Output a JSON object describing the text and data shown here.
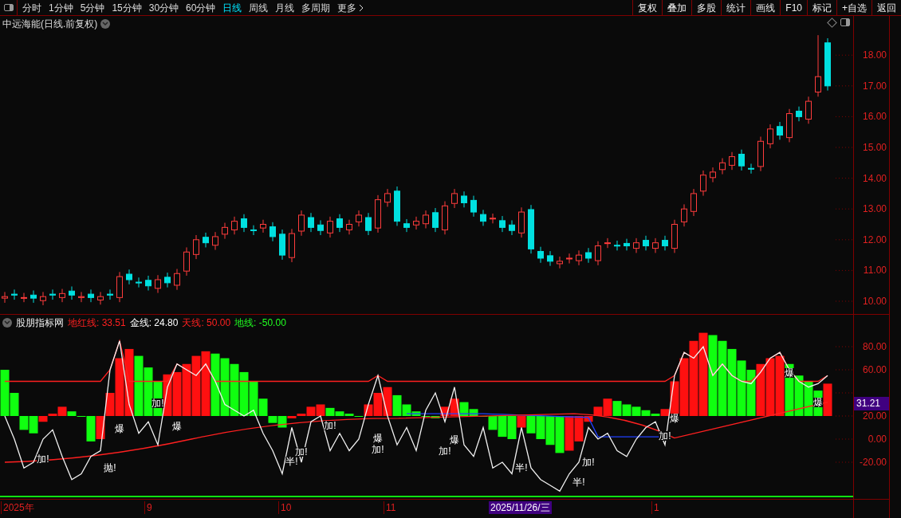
{
  "toolbar": {
    "period_tabs": [
      {
        "label": "分时",
        "selected": false
      },
      {
        "label": "1分钟",
        "selected": false
      },
      {
        "label": "5分钟",
        "selected": false
      },
      {
        "label": "15分钟",
        "selected": false
      },
      {
        "label": "30分钟",
        "selected": false
      },
      {
        "label": "60分钟",
        "selected": false
      },
      {
        "label": "日线",
        "selected": true
      },
      {
        "label": "周线",
        "selected": false
      },
      {
        "label": "月线",
        "selected": false
      },
      {
        "label": "多周期",
        "selected": false
      },
      {
        "label": "更多",
        "selected": false
      }
    ],
    "actions": [
      "复权",
      "叠加",
      "多股",
      "统计",
      "画线",
      "F10",
      "标记",
      "+自选",
      "返回"
    ]
  },
  "price_panel": {
    "title": "中远海能(日线.前复权)",
    "axis_labels": [
      "18.00",
      "17.00",
      "16.00",
      "15.00",
      "14.00",
      "13.00",
      "12.00",
      "11.00",
      "10.00"
    ]
  },
  "indicator_panel": {
    "name": "股朋指标网",
    "legend": [
      {
        "text": "地红线: 33.51",
        "color": "#ff2020"
      },
      {
        "text": "金线: 24.80",
        "color": "#ffffff"
      },
      {
        "text": "天线: 50.00",
        "color": "#ff2020"
      },
      {
        "text": "地线: -50.00",
        "color": "#20ff20"
      }
    ],
    "axis_labels": [
      "80.00",
      "60.00",
      "20.00",
      "0.00",
      "-20.00"
    ],
    "current_value": "31.21",
    "signals": [
      "加!",
      "抛!",
      "爆",
      "加!",
      "爆",
      "半!",
      "加!",
      "加!",
      "爆",
      "加!",
      "加!",
      "爆",
      "半!",
      "半!",
      "加!",
      "加!",
      "爆",
      "爆",
      "爆"
    ]
  },
  "time_axis": {
    "labels": [
      {
        "text": "2025年",
        "selected": false
      },
      {
        "text": "9",
        "selected": false
      },
      {
        "text": "10",
        "selected": false
      },
      {
        "text": "11",
        "selected": false
      },
      {
        "text": "2025/11/26/三",
        "selected": true
      },
      {
        "text": "1",
        "selected": false
      }
    ]
  }
}
